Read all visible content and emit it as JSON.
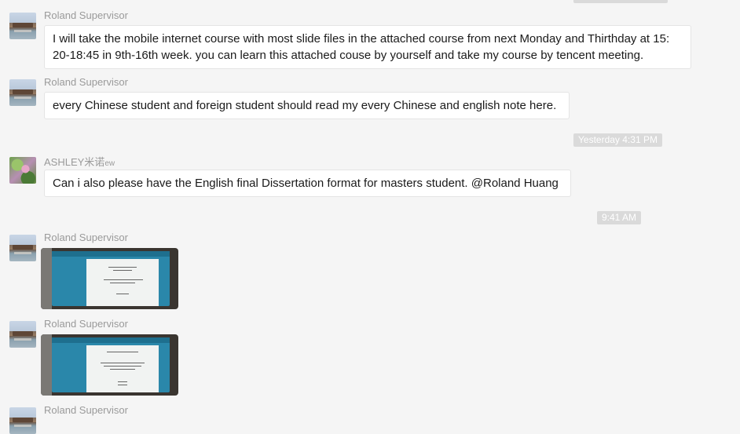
{
  "colors": {
    "background": "#f5f5f5",
    "bubble": "#ffffff",
    "sender_text": "#9a9a9a",
    "timestamp_bg": "#dadada"
  },
  "messages": [
    {
      "sender": "Roland Supervisor",
      "text": "I will take the mobile internet course with most slide files in the attached course from next Monday and Thirthday at 15: 20-18:45 in 9th-16th week. you can learn this attached couse by yourself and take my course by tencent meeting."
    },
    {
      "sender": "Roland Supervisor",
      "text": "every Chinese student and foreign student should read my every Chinese and english note here."
    },
    {
      "timestamp": "Yesterday 4:31 PM"
    },
    {
      "sender": "ASHLEY米诺",
      "sender_suffix": "ew",
      "text": "Can i also please have the English final Dissertation format for masters student. @Roland Huang"
    },
    {
      "timestamp": "9:41 AM"
    },
    {
      "sender": "Roland Supervisor",
      "attachment": "image"
    },
    {
      "sender": "Roland Supervisor",
      "attachment": "image"
    },
    {
      "sender": "Roland Supervisor"
    }
  ]
}
